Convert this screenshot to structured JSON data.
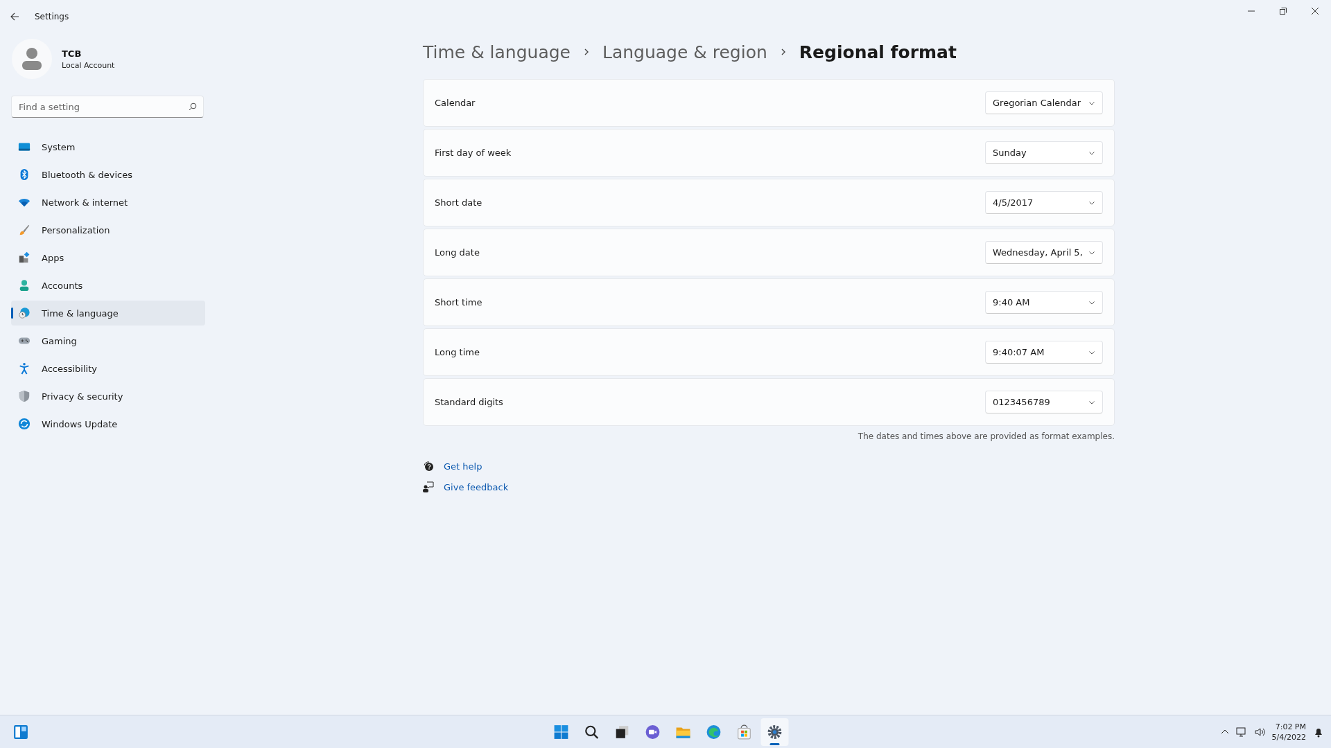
{
  "window": {
    "title": "Settings"
  },
  "account": {
    "name": "TCB",
    "type": "Local Account"
  },
  "search": {
    "placeholder": "Find a setting"
  },
  "nav": [
    {
      "label": "System",
      "selected": false
    },
    {
      "label": "Bluetooth & devices",
      "selected": false
    },
    {
      "label": "Network & internet",
      "selected": false
    },
    {
      "label": "Personalization",
      "selected": false
    },
    {
      "label": "Apps",
      "selected": false
    },
    {
      "label": "Accounts",
      "selected": false
    },
    {
      "label": "Time & language",
      "selected": true
    },
    {
      "label": "Gaming",
      "selected": false
    },
    {
      "label": "Accessibility",
      "selected": false
    },
    {
      "label": "Privacy & security",
      "selected": false
    },
    {
      "label": "Windows Update",
      "selected": false
    }
  ],
  "breadcrumb": [
    "Time & language",
    "Language & region",
    "Regional format"
  ],
  "settings": [
    {
      "label": "Calendar",
      "value": "Gregorian Calendar"
    },
    {
      "label": "First day of week",
      "value": "Sunday"
    },
    {
      "label": "Short date",
      "value": "4/5/2017"
    },
    {
      "label": "Long date",
      "value": "Wednesday, April 5,"
    },
    {
      "label": "Short time",
      "value": "9:40 AM"
    },
    {
      "label": "Long time",
      "value": "9:40:07 AM"
    },
    {
      "label": "Standard digits",
      "value": "0123456789"
    }
  ],
  "note": "The dates and times above are provided as format examples.",
  "links": [
    "Get help",
    "Give feedback"
  ],
  "taskbar": {
    "apps": [
      {
        "selected": false
      },
      {
        "selected": false
      },
      {
        "selected": false
      },
      {
        "selected": false
      },
      {
        "selected": false
      },
      {
        "selected": false
      },
      {
        "selected": false
      },
      {
        "selected": true
      }
    ],
    "time": "7:02 PM",
    "date": "5/4/2022"
  }
}
